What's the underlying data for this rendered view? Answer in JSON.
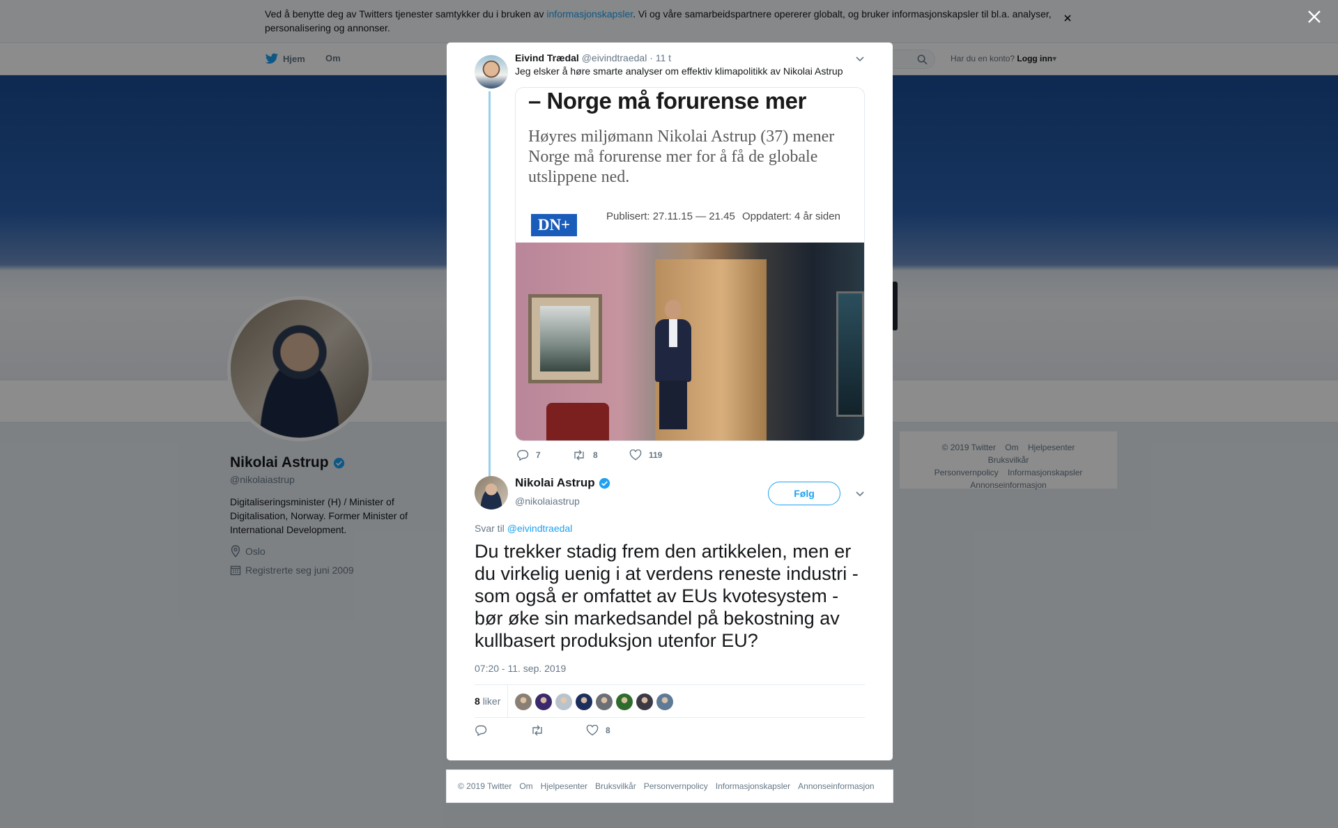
{
  "cookie_banner": {
    "text_before": "Ved å benytte deg av Twitters tjenester samtykker du i bruken av ",
    "link": "informasjonskapsler",
    "text_after": ". Vi og våre samarbeidspartnere opererer globalt, og bruker informasjonskapsler til bl.a. analyser, personalisering og annonser."
  },
  "navbar": {
    "home_label": "Hjem",
    "about_label": "Om",
    "login_prompt": "Har du en konto?",
    "login_label": "Logg inn"
  },
  "profile": {
    "name": "Nikolai Astrup",
    "handle": "@nikolaiastrup",
    "bio": "Digitaliseringsminister (H) / Minister of Digitalisation, Norway. Former Minister of International Development.",
    "location": "Oslo",
    "joined": "Registrerte seg juni 2009"
  },
  "side_footer": {
    "links": [
      "© 2019 Twitter",
      "Om",
      "Hjelpesenter",
      "Bruksvilkår",
      "Personvernpolicy",
      "Informasjonskapsler",
      "Annonseinformasjon"
    ]
  },
  "parent_tweet": {
    "author": "Eivind Trædal",
    "handle": "@eivindtraedal",
    "age": "· 11 t",
    "text": "Jeg elsker å høre smarte analyser om effektiv klimapolitikk av Nikolai Astrup",
    "card": {
      "headline": "– Norge må forurense mer",
      "lead": "Høyres miljømann Nikolai Astrup (37) mener Norge må forurense mer for å få de globale utslippene ned.",
      "logo": "DN+",
      "published": "Publisert: 27.11.15 — 21.45",
      "updated": "Oppdatert: 4 år siden"
    },
    "replies": "7",
    "retweets": "8",
    "likes": "119"
  },
  "main_tweet": {
    "author": "Nikolai Astrup",
    "handle": "@nikolaiastrup",
    "follow_label": "Følg",
    "reply_prefix": "Svar til",
    "reply_to": "@eivindtraedal",
    "text": "Du trekker stadig frem den artikkelen, men er du virkelig uenig i at verdens reneste industri - som også er omfattet av EUs kvotesystem - bør øke sin markedsandel på bekostning av kullbasert produksjon utenfor EU?",
    "timestamp": "07:20 - 11. sep. 2019",
    "likes_count": "8",
    "likes_label": "liker",
    "liker_colors": [
      "#8a7f74",
      "#3b2a6b",
      "#b9c3cc",
      "#1c2f5c",
      "#6c6f76",
      "#2f6b2c",
      "#3a3a44",
      "#5d7a96"
    ],
    "action_likes": "8"
  },
  "modal_footer": {
    "links": [
      "© 2019 Twitter",
      "Om",
      "Hjelpesenter",
      "Bruksvilkår",
      "Personvernpolicy",
      "Informasjonskapsler",
      "Annonseinformasjon"
    ]
  },
  "colors": {
    "accent": "#1da1f2",
    "thread_line": "#98d0eb"
  }
}
